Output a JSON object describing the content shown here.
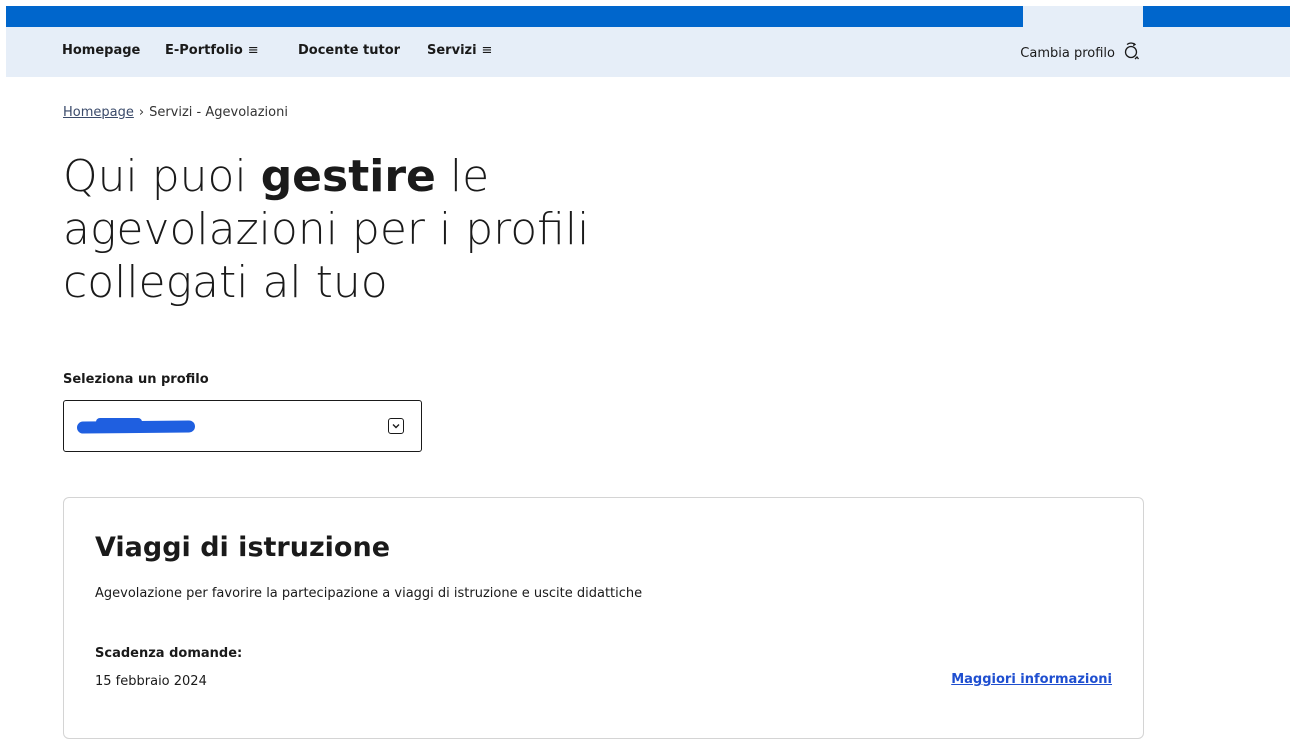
{
  "nav": {
    "items": [
      {
        "label": "Homepage",
        "has_menu": false
      },
      {
        "label": "E-Portfolio",
        "has_menu": true
      },
      {
        "label": "Docente tutor",
        "has_menu": false
      },
      {
        "label": "Servizi",
        "has_menu": true
      }
    ],
    "menu_icon": "hamburger-icon",
    "switch_profile": {
      "label": "Cambia profilo",
      "icon": "switch-profile-icon"
    }
  },
  "breadcrumb": {
    "home": "Homepage",
    "separator": "›",
    "current": "Servizi - Agevolazioni"
  },
  "hero": {
    "prefix": "Qui puoi ",
    "bold": "gestire",
    "suffix": " le agevolazioni per i profili collegati al tuo"
  },
  "profile_select": {
    "label": "Seleziona un profilo",
    "value_redacted": true
  },
  "card": {
    "title": "Viaggi di istruzione",
    "description": "Agevolazione per favorire la partecipazione a viaggi di istruzione e uscite didattiche",
    "deadline_label": "Scadenza domande:",
    "deadline_value": "15 febbraio 2024",
    "more_info_link": "Maggiori informazioni"
  },
  "colors": {
    "brand_blue": "#0066cc",
    "nav_bg": "#e6eef8",
    "link": "#1f4fd0",
    "redaction": "#1f5fe0"
  }
}
